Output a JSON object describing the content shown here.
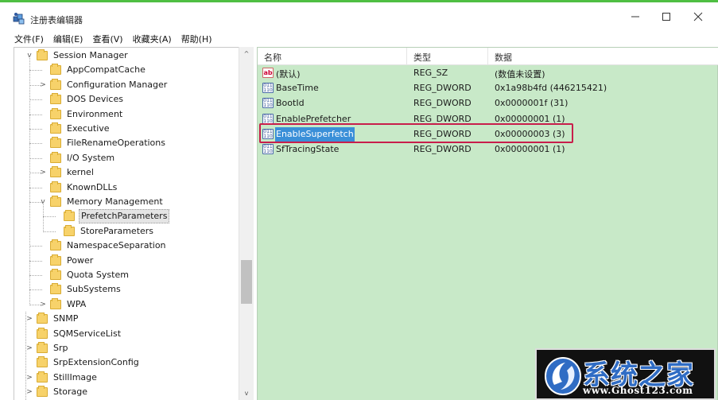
{
  "window": {
    "title": "注册表编辑器",
    "controls": {
      "minimize": "—",
      "maximize": "☐",
      "close": "✕"
    }
  },
  "menu": [
    "文件(F)",
    "编辑(E)",
    "查看(V)",
    "收藏夹(A)",
    "帮助(H)"
  ],
  "tree": {
    "items": [
      {
        "label": "Session Manager",
        "expander": "v"
      },
      {
        "label": "AppCompatCache",
        "expander": ""
      },
      {
        "label": "Configuration Manager",
        "expander": ">"
      },
      {
        "label": "DOS Devices",
        "expander": ""
      },
      {
        "label": "Environment",
        "expander": ""
      },
      {
        "label": "Executive",
        "expander": ""
      },
      {
        "label": "FileRenameOperations",
        "expander": ""
      },
      {
        "label": "I/O System",
        "expander": ""
      },
      {
        "label": "kernel",
        "expander": ">"
      },
      {
        "label": "KnownDLLs",
        "expander": ""
      },
      {
        "label": "Memory Management",
        "expander": "v"
      },
      {
        "label": "PrefetchParameters",
        "expander": "",
        "selected": true
      },
      {
        "label": "StoreParameters",
        "expander": ""
      },
      {
        "label": "NamespaceSeparation",
        "expander": ""
      },
      {
        "label": "Power",
        "expander": ""
      },
      {
        "label": "Quota System",
        "expander": ""
      },
      {
        "label": "SubSystems",
        "expander": ""
      },
      {
        "label": "WPA",
        "expander": ">"
      },
      {
        "label": "SNMP",
        "expander": ">"
      },
      {
        "label": "SQMServiceList",
        "expander": ""
      },
      {
        "label": "Srp",
        "expander": ">"
      },
      {
        "label": "SrpExtensionConfig",
        "expander": ""
      },
      {
        "label": "StillImage",
        "expander": ">"
      },
      {
        "label": "Storage",
        "expander": ">"
      }
    ],
    "scroll": {
      "up": "^",
      "down": "v"
    }
  },
  "list": {
    "columns": {
      "name": "名称",
      "type": "类型",
      "data": "数据"
    },
    "rows": [
      {
        "icon": "ab",
        "name": "(默认)",
        "type": "REG_SZ",
        "data": "(数值未设置)"
      },
      {
        "icon": "bin",
        "name": "BaseTime",
        "type": "REG_DWORD",
        "data": "0x1a98b4fd (446215421)"
      },
      {
        "icon": "bin",
        "name": "BootId",
        "type": "REG_DWORD",
        "data": "0x0000001f (31)"
      },
      {
        "icon": "bin",
        "name": "EnablePrefetcher",
        "type": "REG_DWORD",
        "data": "0x00000001 (1)"
      },
      {
        "icon": "bin",
        "name": "EnableSuperfetch",
        "type": "REG_DWORD",
        "data": "0x00000003 (3)",
        "selected": true
      },
      {
        "icon": "bin",
        "name": "SfTracingState",
        "type": "REG_DWORD",
        "data": "0x00000001 (1)"
      }
    ],
    "icon_labels": {
      "ab": "ab",
      "bin": "011 110"
    }
  },
  "watermark": {
    "title": "系统之家",
    "url": "www.Ghost123.com"
  },
  "colors": {
    "accent": "#4fbf43",
    "list_background": "#c8e9c8",
    "selection": "#3a8fd8",
    "highlight_border": "#c81e4b",
    "logo_blue": "#2f6cc4"
  }
}
